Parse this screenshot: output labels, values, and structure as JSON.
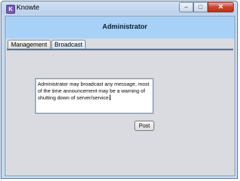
{
  "window": {
    "title": "Knowte",
    "app_icon_letter": "K",
    "minimize_glyph": "–",
    "maximize_glyph": "□",
    "close_glyph": "✕"
  },
  "header": {
    "title": "Administrator"
  },
  "tabs": [
    {
      "label": "Management",
      "active": false
    },
    {
      "label": "Broadcast",
      "active": true
    }
  ],
  "broadcast": {
    "message": "Administrator may broadcast any message, most of the time announcement may be a warning of shutting down of server/service.",
    "post_label": "Post"
  },
  "colors": {
    "banner": "#a7d1f7",
    "panel": "#d9dbe0"
  },
  "icons": {
    "app": "app-icon",
    "minimize": "minimize-icon",
    "maximize": "maximize-icon",
    "close": "close-icon"
  }
}
